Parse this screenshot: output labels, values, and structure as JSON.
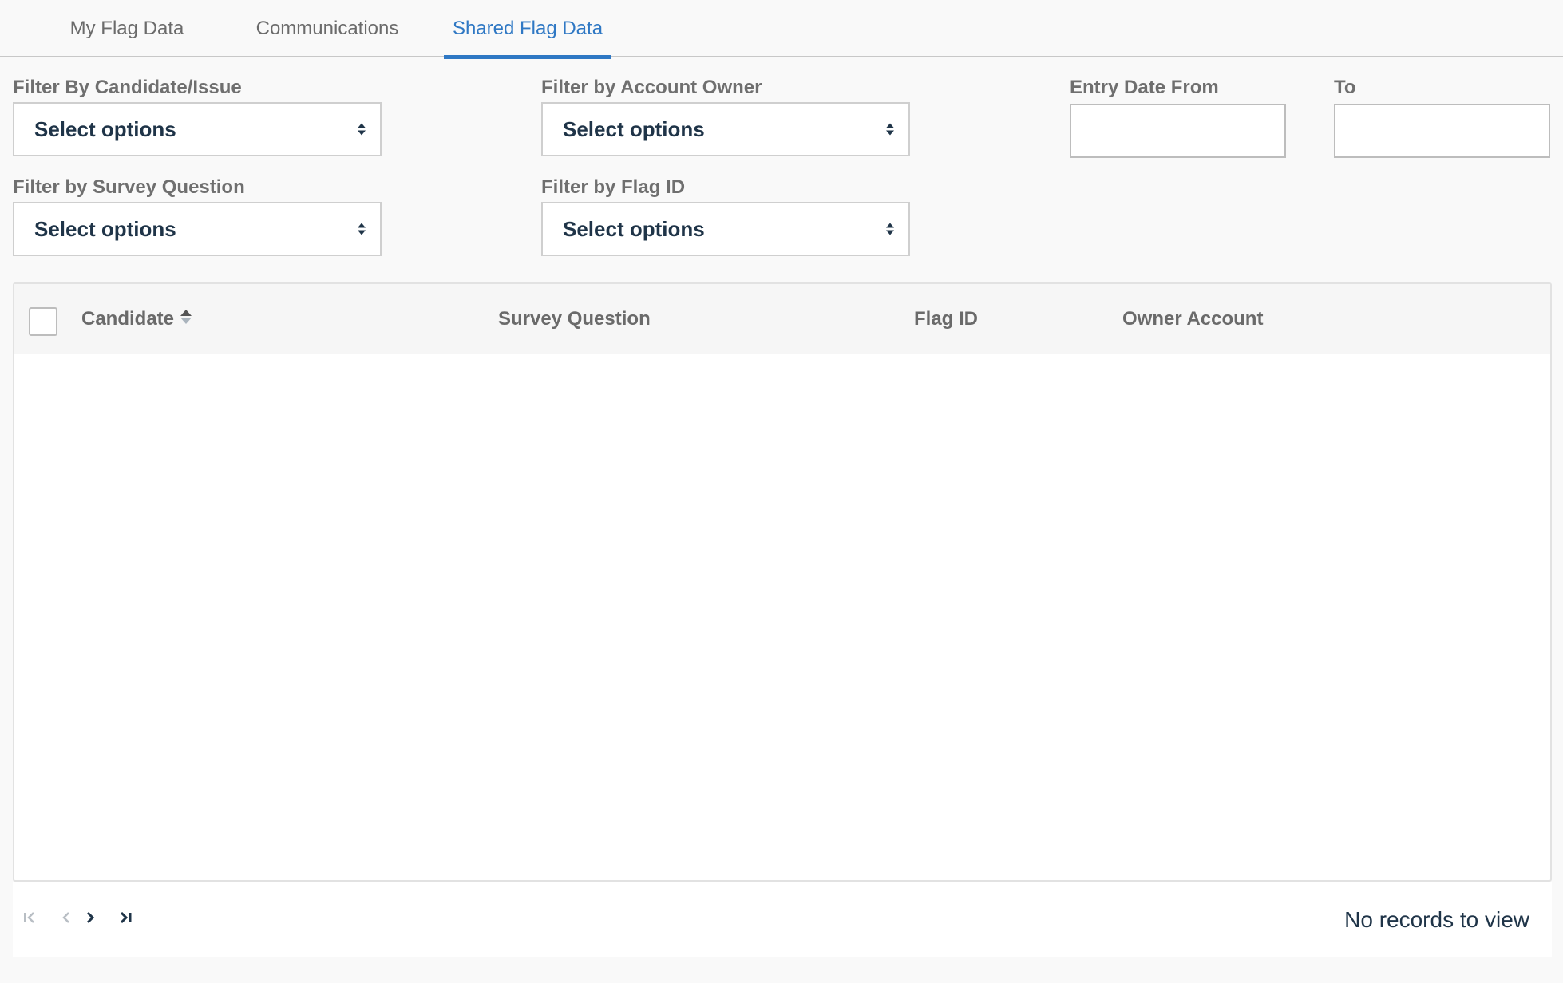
{
  "tabs": [
    {
      "label": "My Flag Data",
      "active": false
    },
    {
      "label": "Communications",
      "active": false
    },
    {
      "label": "Shared Flag Data",
      "active": true
    }
  ],
  "accent_color": "#2f78c4",
  "filters": {
    "candidate_issue": {
      "label": "Filter By Candidate/Issue",
      "value": "Select options"
    },
    "account_owner": {
      "label": "Filter by Account Owner",
      "value": "Select options"
    },
    "survey_question": {
      "label": "Filter by Survey Question",
      "value": "Select options"
    },
    "flag_id": {
      "label": "Filter by Flag ID",
      "value": "Select options"
    },
    "entry_date_from": {
      "label": "Entry Date From",
      "value": ""
    },
    "entry_date_to": {
      "label": "To",
      "value": ""
    }
  },
  "grid": {
    "columns": [
      "Candidate",
      "Survey Question",
      "Flag ID",
      "Owner Account"
    ],
    "rows": []
  },
  "pager": {
    "status": "No records to view",
    "icons": [
      "first-page-icon",
      "prev-page-icon",
      "next-page-icon",
      "last-page-icon"
    ]
  }
}
